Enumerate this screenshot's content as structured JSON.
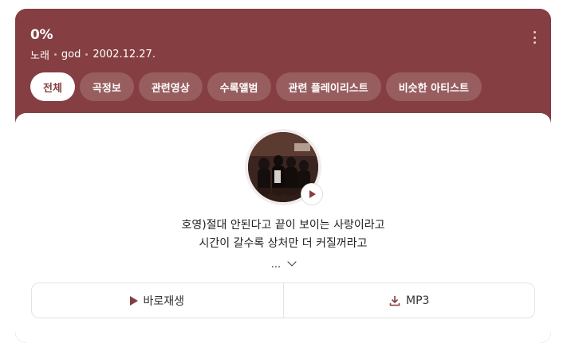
{
  "song": {
    "title": "0%",
    "type": "노래",
    "artist": "god",
    "date": "2002.12.27."
  },
  "tabs": [
    {
      "label": "전체",
      "active": true
    },
    {
      "label": "곡정보",
      "active": false
    },
    {
      "label": "관련영상",
      "active": false
    },
    {
      "label": "수록앨범",
      "active": false
    },
    {
      "label": "관련 플레이리스트",
      "active": false
    },
    {
      "label": "비슷한 아티스트",
      "active": false
    }
  ],
  "lyrics": {
    "line1": "호영)절대 안된다고 끝이 보이는 사랑이라고",
    "line2": "시간이 갈수록 상처만 더 커질꺼라고",
    "expand": "..."
  },
  "actions": {
    "play_label": "바로재생",
    "mp3_label": "MP3"
  },
  "colors": {
    "accent": "#853e41",
    "tab_bg": "#a0595c"
  },
  "icons": {
    "more": "more-vertical-icon",
    "play": "play-icon",
    "download": "download-icon",
    "chevron": "chevron-down-icon"
  }
}
